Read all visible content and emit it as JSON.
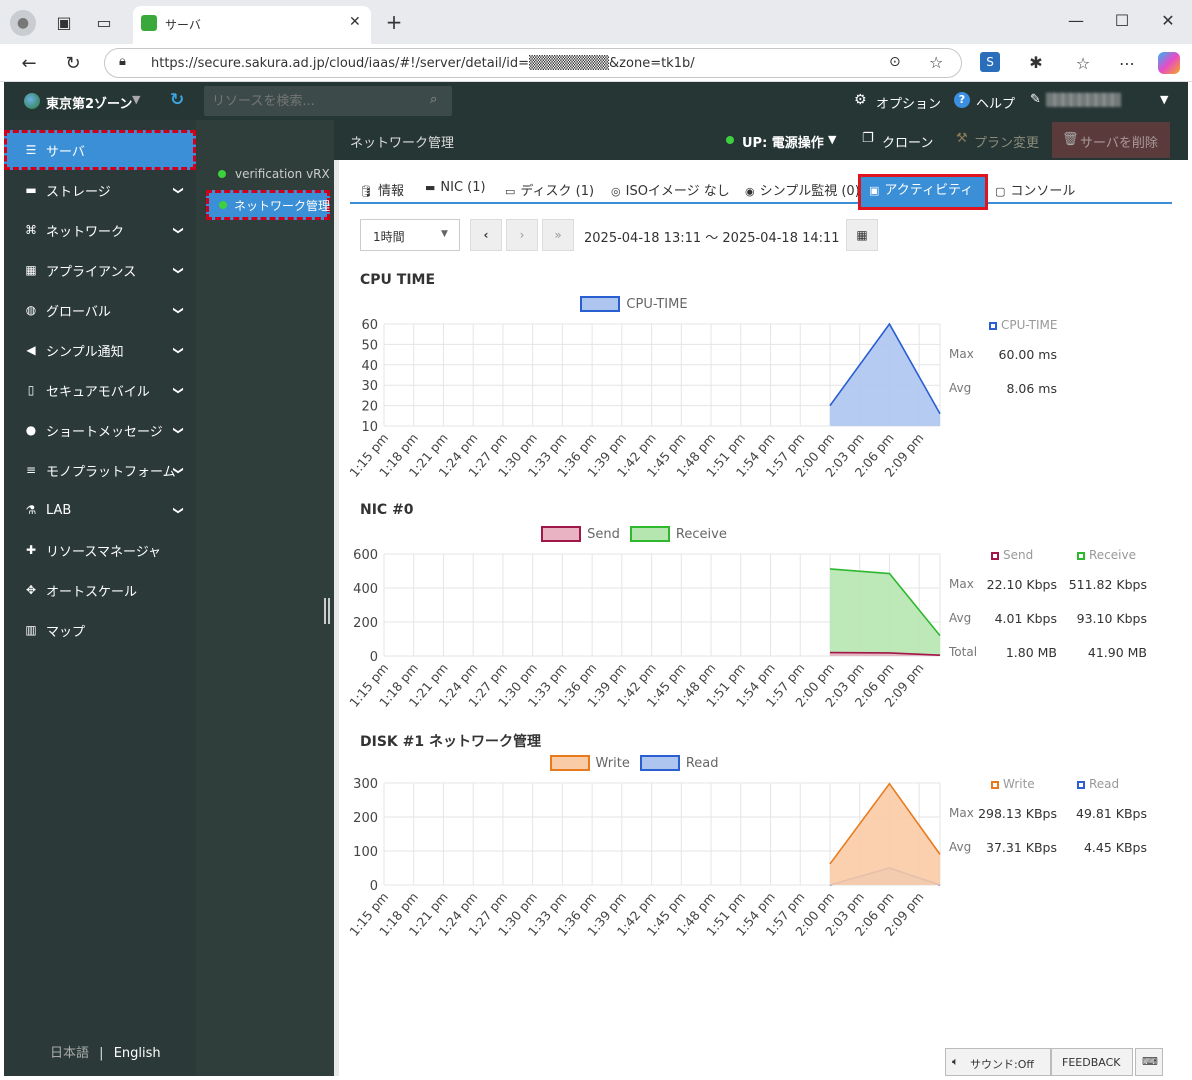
{
  "browser": {
    "tab_title": "サーバ",
    "url": "https://secure.sakura.ad.jp/cloud/iaas/#!/server/detail/id=▒▒▒▒▒▒▒▒&zone=tk1b/"
  },
  "header": {
    "zone": "東京第2ゾーン",
    "search_placeholder": "リソースを検索...",
    "options": "オプション",
    "help": "ヘルプ",
    "user": "▒▒▒▒▒▒▒▒▒"
  },
  "sidebar": {
    "items": [
      {
        "label": "サーバ",
        "icon": "server-icon"
      },
      {
        "label": "ストレージ",
        "icon": "storage-icon"
      },
      {
        "label": "ネットワーク",
        "icon": "network-icon"
      },
      {
        "label": "アプライアンス",
        "icon": "appliance-icon"
      },
      {
        "label": "グローバル",
        "icon": "globe-icon"
      },
      {
        "label": "シンプル通知",
        "icon": "megaphone-icon"
      },
      {
        "label": "セキュアモバイル",
        "icon": "mobile-icon"
      },
      {
        "label": "ショートメッセージ",
        "icon": "chat-icon"
      },
      {
        "label": "モノプラットフォーム",
        "icon": "list-icon"
      },
      {
        "label": "LAB",
        "icon": "flask-icon"
      },
      {
        "label": "リソースマネージャ",
        "icon": "puzzle-icon"
      },
      {
        "label": "オートスケール",
        "icon": "arrows-icon"
      },
      {
        "label": "マップ",
        "icon": "map-icon"
      }
    ],
    "lang_ja": "日本語",
    "lang_sep": "|",
    "lang_en": "English"
  },
  "subsidebar": {
    "items": [
      "verification vRX",
      "ネットワーク管理"
    ]
  },
  "contentbar": {
    "title": "ネットワーク管理",
    "power": "UP: 電源操作",
    "clone": "クローン",
    "plan": "プラン変更",
    "delete": "サーバを削除"
  },
  "tabs": [
    {
      "label": "情報"
    },
    {
      "label": "NIC (1)"
    },
    {
      "label": "ディスク (1)"
    },
    {
      "label": "ISOイメージ なし"
    },
    {
      "label": "シンプル監視 (0)"
    },
    {
      "label": "アクティビティ"
    },
    {
      "label": "コンソール"
    }
  ],
  "range": {
    "select": "1時間",
    "text": "2025-04-18 13:11 ～ 2025-04-18 14:11"
  },
  "footer": {
    "sound": "サウンド:Off",
    "feedback": "FEEDBACK"
  },
  "chart_data": [
    {
      "type": "area",
      "title": "CPU TIME",
      "x": [
        "1:15 pm",
        "1:18 pm",
        "1:21 pm",
        "1:24 pm",
        "1:27 pm",
        "1:30 pm",
        "1:33 pm",
        "1:36 pm",
        "1:39 pm",
        "1:42 pm",
        "1:45 pm",
        "1:48 pm",
        "1:51 pm",
        "1:54 pm",
        "1:57 pm",
        "2:00 pm",
        "2:03 pm",
        "2:06 pm",
        "2:09 pm"
      ],
      "ylim": [
        10,
        60
      ],
      "yticks": [
        60,
        50,
        40,
        30,
        20,
        10
      ],
      "series": [
        {
          "name": "CPU-TIME",
          "color": "#2a5fd1",
          "fill": "#aec5f0",
          "points": [
            [
              "2:00 pm",
              20
            ],
            [
              "2:06 pm",
              60
            ],
            [
              "2:11 pm",
              16
            ]
          ]
        }
      ],
      "stats_headers": [
        "CPU-TIME"
      ],
      "stats": [
        {
          "label": "Max",
          "values": [
            "60.00 ms"
          ]
        },
        {
          "label": "Avg",
          "values": [
            "8.06 ms"
          ]
        }
      ]
    },
    {
      "type": "area",
      "title": "NIC #0",
      "x": [
        "1:15 pm",
        "1:18 pm",
        "1:21 pm",
        "1:24 pm",
        "1:27 pm",
        "1:30 pm",
        "1:33 pm",
        "1:36 pm",
        "1:39 pm",
        "1:42 pm",
        "1:45 pm",
        "1:48 pm",
        "1:51 pm",
        "1:54 pm",
        "1:57 pm",
        "2:00 pm",
        "2:03 pm",
        "2:06 pm",
        "2:09 pm"
      ],
      "ylim": [
        0,
        600
      ],
      "yticks": [
        600,
        400,
        200,
        0
      ],
      "series": [
        {
          "name": "Send",
          "color": "#a0174a",
          "fill": "#e9b3c4",
          "points": [
            [
              "2:00 pm",
              20
            ],
            [
              "2:06 pm",
              18
            ],
            [
              "2:11 pm",
              5
            ]
          ]
        },
        {
          "name": "Receive",
          "color": "#2eb82e",
          "fill": "#b6e6b0",
          "points": [
            [
              "2:00 pm",
              512
            ],
            [
              "2:06 pm",
              485
            ],
            [
              "2:11 pm",
              120
            ]
          ]
        }
      ],
      "stats_headers": [
        "Send",
        "Receive"
      ],
      "stats": [
        {
          "label": "Max",
          "values": [
            "22.10 Kbps",
            "511.82 Kbps"
          ]
        },
        {
          "label": "Avg",
          "values": [
            "4.01 Kbps",
            "93.10 Kbps"
          ]
        },
        {
          "label": "Total",
          "values": [
            "1.80 MB",
            "41.90 MB"
          ]
        }
      ]
    },
    {
      "type": "area",
      "title": "DISK #1 ネットワーク管理",
      "x": [
        "1:15 pm",
        "1:18 pm",
        "1:21 pm",
        "1:24 pm",
        "1:27 pm",
        "1:30 pm",
        "1:33 pm",
        "1:36 pm",
        "1:39 pm",
        "1:42 pm",
        "1:45 pm",
        "1:48 pm",
        "1:51 pm",
        "1:54 pm",
        "1:57 pm",
        "2:00 pm",
        "2:03 pm",
        "2:06 pm",
        "2:09 pm"
      ],
      "ylim": [
        0,
        300
      ],
      "yticks": [
        300,
        200,
        100,
        0
      ],
      "series": [
        {
          "name": "Write",
          "color": "#e87a1e",
          "fill": "#f9cba6",
          "points": [
            [
              "2:00 pm",
              62
            ],
            [
              "2:06 pm",
              298
            ],
            [
              "2:11 pm",
              90
            ]
          ]
        },
        {
          "name": "Read",
          "color": "#2a5fd1",
          "fill": "#aec5f0",
          "points": [
            [
              "2:00 pm",
              0
            ],
            [
              "2:06 pm",
              50
            ],
            [
              "2:11 pm",
              0
            ]
          ]
        }
      ],
      "stats_headers": [
        "Write",
        "Read"
      ],
      "stats": [
        {
          "label": "Max",
          "values": [
            "298.13 KBps",
            "49.81 KBps"
          ]
        },
        {
          "label": "Avg",
          "values": [
            "37.31 KBps",
            "4.45 KBps"
          ]
        }
      ]
    }
  ]
}
